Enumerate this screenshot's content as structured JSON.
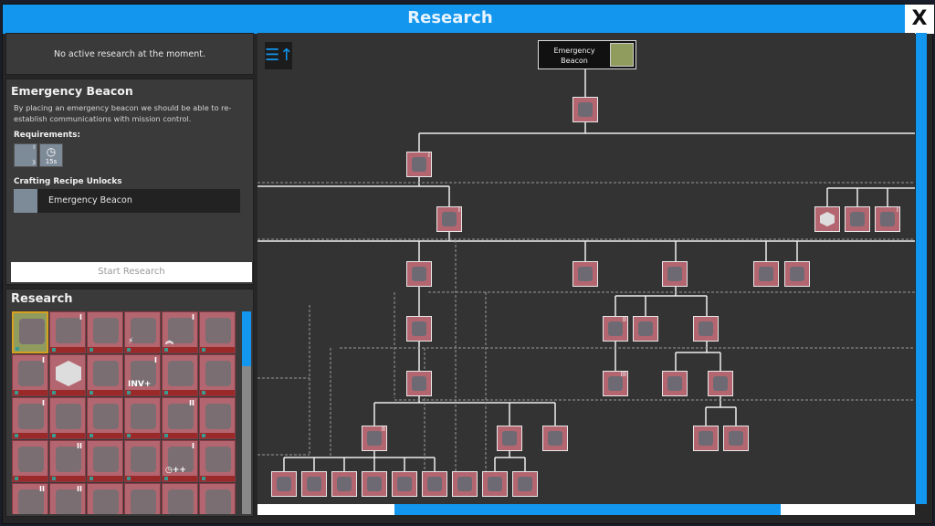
{
  "window": {
    "title": "Research",
    "close_label": "X"
  },
  "active_research": {
    "text": "No active research at the moment."
  },
  "detail": {
    "title": "Emergency Beacon",
    "description": "By placing an emergency beacon we should be able to re-establish communications with mission control.",
    "requirements_label": "Requirements:",
    "requirements": [
      {
        "icon": "component-icon",
        "count": "3",
        "tier": "I"
      },
      {
        "icon": "clock-icon",
        "glyph": "◷",
        "time": "15s"
      }
    ],
    "unlocks_label": "Crafting Recipe Unlocks",
    "unlocks": [
      {
        "icon": "emergency-beacon-icon",
        "name": "Emergency Beacon"
      }
    ],
    "start_button": "Start Research"
  },
  "research_list": {
    "title": "Research",
    "items": [
      {
        "icon": "emergency-beacon-icon",
        "tier": "",
        "overlay": "",
        "selected": true
      },
      {
        "icon": "smelter-icon",
        "tier": "I",
        "overlay": ""
      },
      {
        "icon": "crate-icon",
        "tier": "",
        "overlay": ""
      },
      {
        "icon": "power-generator-icon",
        "tier": "",
        "overlay": "⚡"
      },
      {
        "icon": "drone-upgrade-icon",
        "tier": "I",
        "overlay": "︽"
      },
      {
        "icon": "storage-tank-icon",
        "tier": "",
        "overlay": ""
      },
      {
        "icon": "conveyor-icon",
        "tier": "I",
        "overlay": ""
      },
      {
        "icon": "hexagon-icon",
        "tier": "",
        "overlay": "",
        "hex": true
      },
      {
        "icon": "wall-icon",
        "tier": "",
        "overlay": ""
      },
      {
        "icon": "drone-inventory-icon",
        "tier": "I",
        "overlay": "INV+"
      },
      {
        "icon": "gate-icon",
        "tier": "",
        "overlay": ""
      },
      {
        "icon": "lamp-icon",
        "tier": "",
        "overlay": ""
      },
      {
        "icon": "loader-icon",
        "tier": "I",
        "overlay": ""
      },
      {
        "icon": "drill-icon",
        "tier": "",
        "overlay": ""
      },
      {
        "icon": "pump-icon",
        "tier": "",
        "overlay": ""
      },
      {
        "icon": "fence-icon",
        "tier": "",
        "overlay": ""
      },
      {
        "icon": "assembler-icon",
        "tier": "II",
        "overlay": ""
      },
      {
        "icon": "monitor-icon",
        "tier": "",
        "overlay": ""
      },
      {
        "icon": "stairs-icon",
        "tier": "",
        "overlay": ""
      },
      {
        "icon": "smelter-icon",
        "tier": "II",
        "overlay": ""
      },
      {
        "icon": "belt-icon",
        "tier": "",
        "overlay": ""
      },
      {
        "icon": "ore-pile-icon",
        "tier": "",
        "overlay": ""
      },
      {
        "icon": "drone-speed-icon",
        "tier": "I",
        "overlay": "◷++"
      },
      {
        "icon": "materials-icon",
        "tier": "",
        "overlay": ""
      },
      {
        "icon": "conveyor-icon",
        "tier": "II",
        "overlay": ""
      },
      {
        "icon": "loader-icon",
        "tier": "II",
        "overlay": ""
      },
      {
        "icon": "splitter-icon",
        "tier": "",
        "overlay": ""
      },
      {
        "icon": "furnace-icon",
        "tier": "",
        "overlay": ""
      },
      {
        "icon": "machine-icon",
        "tier": "",
        "overlay": ""
      },
      {
        "icon": "battery-icon",
        "tier": "",
        "overlay": ""
      }
    ]
  },
  "tree": {
    "sort_icon": "sort-icon",
    "sort_glyph": "☰↑",
    "root": {
      "name": "Emergency Beacon",
      "icon": "emergency-beacon-icon"
    },
    "nodes": [
      {
        "icon": "smelter-icon",
        "tier": ""
      },
      {
        "icon": "drone-upgrade-icon",
        "tier": "I"
      },
      {
        "icon": "assembler-icon",
        "tier": "I"
      },
      {
        "icon": "hexagon-icon",
        "tier": "",
        "hex": true
      },
      {
        "icon": "storage-tank-icon",
        "tier": ""
      },
      {
        "icon": "conveyor-icon",
        "tier": "I"
      },
      {
        "icon": "plate-icon",
        "tier": ""
      },
      {
        "icon": "tools-icon",
        "tier": ""
      },
      {
        "icon": "belt-icon",
        "tier": ""
      },
      {
        "icon": "ingot-icon",
        "tier": ""
      },
      {
        "icon": "pump-icon",
        "tier": ""
      },
      {
        "icon": "crystal-icon",
        "tier": ""
      },
      {
        "icon": "smelter-icon",
        "tier": "II"
      },
      {
        "icon": "disabled-icon",
        "tier": ""
      },
      {
        "icon": "pipe-icon",
        "tier": ""
      },
      {
        "icon": "ore-pile-icon",
        "tier": ""
      },
      {
        "icon": "smelter-icon",
        "tier": "III"
      },
      {
        "icon": "crate-icon",
        "tier": ""
      },
      {
        "icon": "vehicle-icon",
        "tier": ""
      },
      {
        "icon": "assembler-icon",
        "tier": "II"
      },
      {
        "icon": "conveyor-icon",
        "tier": ""
      },
      {
        "icon": "machine-icon",
        "tier": ""
      },
      {
        "icon": "nozzle-icon",
        "tier": ""
      },
      {
        "icon": "engine-icon",
        "tier": ""
      },
      {
        "icon": "drone-upgrade-icon",
        "tier": ""
      },
      {
        "icon": "production-boost-icon",
        "tier": ""
      },
      {
        "icon": "pump-icon",
        "tier": ""
      },
      {
        "icon": "machine-icon",
        "tier": ""
      },
      {
        "icon": "loader-icon",
        "tier": ""
      },
      {
        "icon": "wall-icon",
        "tier": ""
      },
      {
        "icon": "ramp-icon",
        "tier": ""
      },
      {
        "icon": "furnace-icon",
        "tier": ""
      },
      {
        "icon": "generator-icon",
        "tier": ""
      }
    ]
  },
  "scroll": {
    "horizontal_position": 0.21,
    "horizontal_visible": 0.59
  }
}
